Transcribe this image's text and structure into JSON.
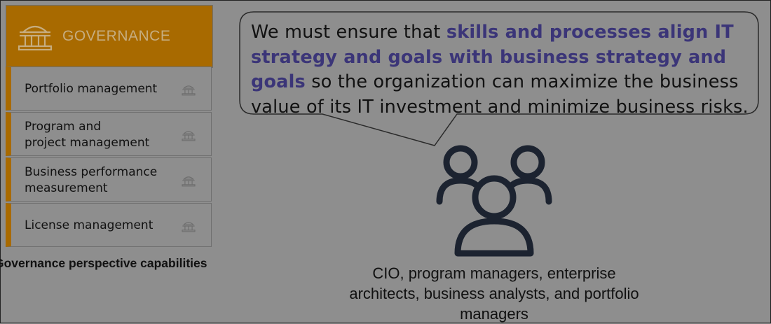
{
  "governance": {
    "title": "GOVERNANCE",
    "icon": "building-columns-icon",
    "items": [
      {
        "label": "Portfolio management",
        "icon": "building-columns-icon"
      },
      {
        "label": "Program and\nproject management",
        "icon": "building-columns-icon"
      },
      {
        "label": "Business performance\nmeasurement",
        "icon": "building-columns-icon"
      },
      {
        "label": "License management",
        "icon": "building-columns-icon"
      }
    ],
    "caption": "Governance perspective capabilities"
  },
  "bubble": {
    "text_before": "We must ensure that ",
    "highlight": "skills and processes align IT strategy and goals with business strategy and goals",
    "text_after": " so the organization can maximize the business value of its IT investment and minimize business risks."
  },
  "stakeholders": {
    "icon": "people-group-icon",
    "caption": "CIO, program managers, enterprise architects, business analysts, and portfolio managers"
  },
  "colors": {
    "accent": "#a86a00",
    "highlight": "#3b3578",
    "background": "#8e8e8e"
  }
}
